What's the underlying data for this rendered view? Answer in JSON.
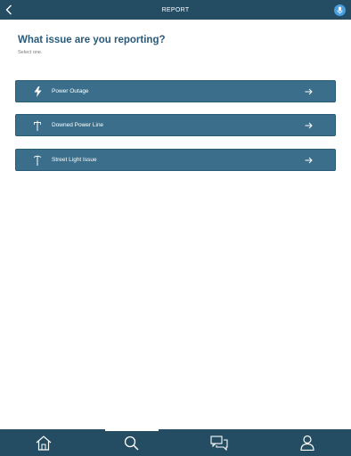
{
  "header": {
    "title": "REPORT",
    "back_icon": "chevron-left-icon",
    "mic_icon": "microphone-icon"
  },
  "main": {
    "heading": "What issue are you reporting?",
    "subheading": "Select one.",
    "options": [
      {
        "label": "Power Outage",
        "icon": "lightning-bolt-icon"
      },
      {
        "label": "Downed Power Line",
        "icon": "power-pole-icon"
      },
      {
        "label": "Street Light Issue",
        "icon": "street-light-icon"
      }
    ]
  },
  "bottom_nav": {
    "items": [
      {
        "name": "home",
        "icon": "home-icon"
      },
      {
        "name": "search",
        "icon": "search-icon",
        "active": true
      },
      {
        "name": "messages",
        "icon": "chat-icon"
      },
      {
        "name": "profile",
        "icon": "user-icon"
      }
    ]
  },
  "colors": {
    "header_bg": "#244c63",
    "button_bg": "#3b6e8a",
    "heading": "#2a5a7a",
    "mic_accent": "#4a9fe0"
  }
}
